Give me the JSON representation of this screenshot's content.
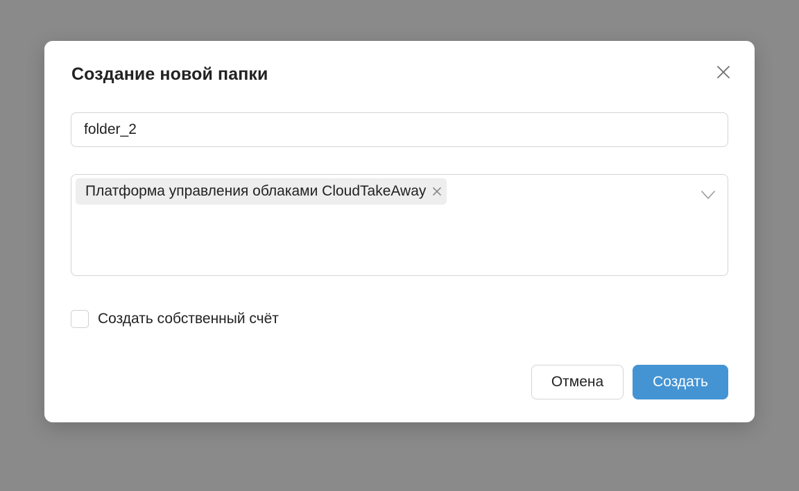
{
  "dialog": {
    "title": "Создание новой папки",
    "close_icon": "close-icon"
  },
  "form": {
    "folder_name_value": "folder_2",
    "cloud_select": {
      "selected_tags": [
        {
          "label": "Платформа управления облаками CloudTakeAway",
          "remove_icon": "close-small-icon"
        }
      ],
      "dropdown_icon": "chevron-down-icon"
    },
    "own_account_checkbox": {
      "label": "Создать собственный счёт",
      "checked": false
    }
  },
  "actions": {
    "cancel_label": "Отмена",
    "create_label": "Создать"
  },
  "colors": {
    "overlay": "#8a8a8a",
    "primary": "#4494d4",
    "tag_background": "#eeeeee",
    "border": "#d4d4d4"
  }
}
